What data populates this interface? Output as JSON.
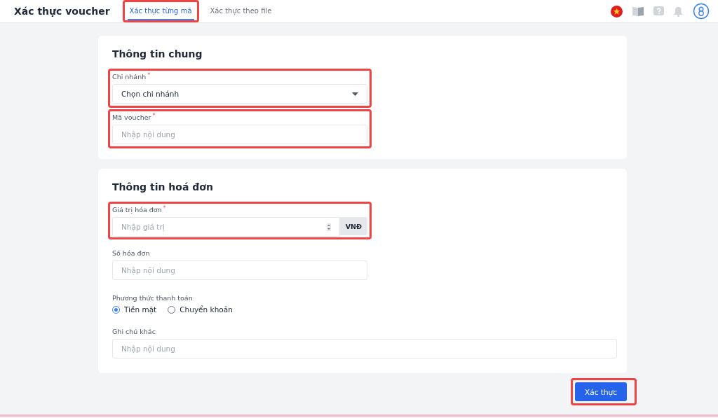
{
  "header": {
    "title": "Xác thực voucher",
    "tabs": [
      {
        "label": "Xác thực từng mã",
        "selected": true,
        "highlighted": true
      },
      {
        "label": "Xác thực theo file",
        "selected": false,
        "highlighted": false
      }
    ]
  },
  "sections": [
    {
      "title": "Thông tin chung",
      "fields": [
        {
          "kind": "select",
          "label": "Chi nhánh",
          "required_mark": "*",
          "value": "Chọn chi nhánh",
          "highlighted": true
        },
        {
          "kind": "text",
          "label": "Mã voucher",
          "required_mark": "*",
          "placeholder": "Nhập nội dung",
          "highlighted": true
        }
      ]
    },
    {
      "title": "Thông tin hoá đơn",
      "fields": [
        {
          "kind": "number",
          "label": "Giá trị hóa đơn",
          "required_mark": "*",
          "placeholder": "Nhập giá trị",
          "unit": "VNĐ",
          "highlighted": true
        },
        {
          "kind": "text",
          "label": "Số hóa đơn",
          "placeholder": "Nhập nội dung",
          "highlighted": false
        },
        {
          "kind": "radio",
          "label": "Phương thức thanh toán",
          "highlighted": false,
          "options": [
            {
              "label": "Tiền mặt",
              "selected": true
            },
            {
              "label": "Chuyển khoản",
              "selected": false
            }
          ]
        },
        {
          "kind": "wide",
          "label": "Ghi chú khác",
          "placeholder": "Nhập nội dung",
          "highlighted": false
        }
      ]
    }
  ],
  "submit": {
    "label": "Xác thực",
    "highlighted": true
  }
}
